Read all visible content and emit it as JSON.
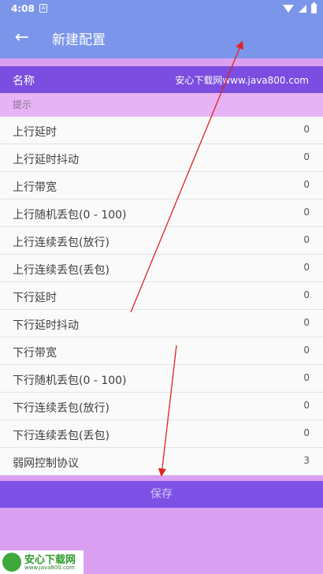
{
  "status_bar": {
    "time": "4:08",
    "notif_glyph": "A",
    "icons": [
      "wifi-icon",
      "signal-icon",
      "battery-icon"
    ]
  },
  "app_bar": {
    "back_glyph": "←",
    "title": "新建配置"
  },
  "name_row": {
    "label": "名称",
    "value": "安心下载网www.java800.com"
  },
  "hint_row": {
    "text": "提示"
  },
  "list": {
    "items": [
      {
        "label": "上行延时",
        "value": "0"
      },
      {
        "label": "上行延时抖动",
        "value": "0"
      },
      {
        "label": "上行带宽",
        "value": "0"
      },
      {
        "label": "上行随机丢包(0 - 100)",
        "value": "0"
      },
      {
        "label": "上行连续丢包(放行)",
        "value": "0"
      },
      {
        "label": "上行连续丢包(丢包)",
        "value": "0"
      },
      {
        "label": "下行延时",
        "value": "0"
      },
      {
        "label": "下行延时抖动",
        "value": "0"
      },
      {
        "label": "下行带宽",
        "value": "0"
      },
      {
        "label": "下行随机丢包(0 - 100)",
        "value": "0"
      },
      {
        "label": "下行连续丢包(放行)",
        "value": "0"
      },
      {
        "label": "下行连续丢包(丢包)",
        "value": "0"
      },
      {
        "label": "弱网控制协议",
        "value": "3"
      }
    ]
  },
  "save_button": {
    "label": "保存"
  },
  "watermark": {
    "title": "安心下载网",
    "url": "www.java800.com"
  },
  "colors": {
    "app_bar": "#7a95ea",
    "name_row": "#7b4de0",
    "save_button": "#7d50e6",
    "background": "#d9a0f2",
    "annotation_arrow": "#e0231e"
  }
}
